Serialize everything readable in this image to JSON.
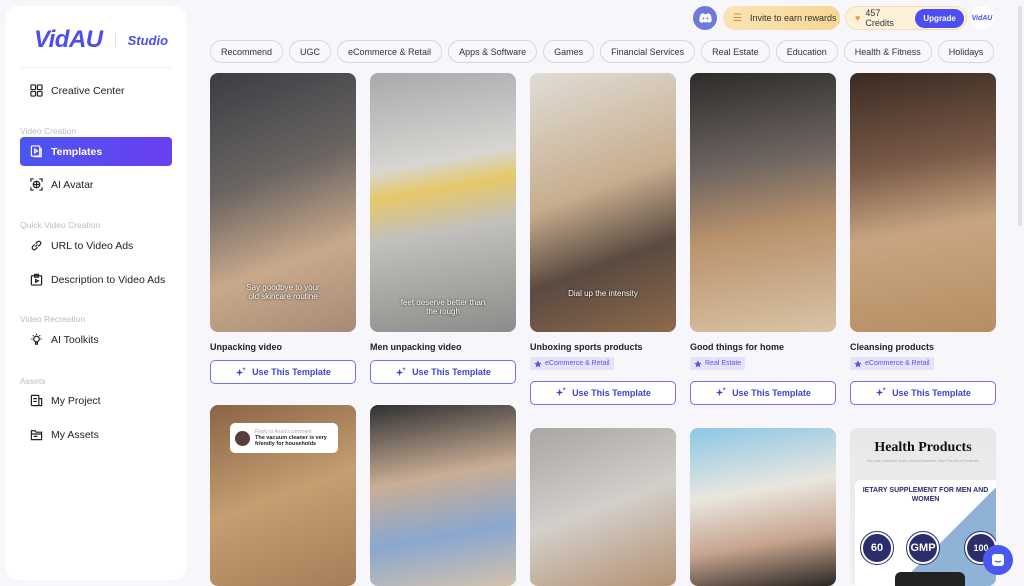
{
  "sidebar": {
    "brand": "VidAU",
    "studio": "Studio",
    "items": [
      {
        "label": "Creative Center",
        "icon": "grid-icon"
      },
      {
        "section": "Video Creation"
      },
      {
        "label": "Templates",
        "icon": "template-icon",
        "active": true
      },
      {
        "label": "AI Avatar",
        "icon": "avatar-scan-icon"
      },
      {
        "section": "Quick Video Creation"
      },
      {
        "label": "URL to Video Ads",
        "icon": "link-icon"
      },
      {
        "label": "Description to Video Ads",
        "icon": "clipboard-video-icon"
      },
      {
        "section": "Video Recreation"
      },
      {
        "label": "AI Toolkits",
        "icon": "bulb-icon"
      },
      {
        "section": "Assets"
      },
      {
        "label": "My Project",
        "icon": "project-icon"
      },
      {
        "label": "My Assets",
        "icon": "folder-icon"
      }
    ]
  },
  "topbar": {
    "invite": "Invite to earn rewards",
    "credits": "457 Credits",
    "upgrade": "Upgrade",
    "avatar": "VidAU"
  },
  "categories": [
    "Recommend",
    "UGC",
    "eCommerce & Retail",
    "Apps & Software",
    "Games",
    "Financial Services",
    "Real Estate",
    "Education",
    "Health & Fitness",
    "Holidays"
  ],
  "use_label": "Use This Template",
  "row1": [
    {
      "title": "Unpacking video",
      "caption": "Say goodbye to your old skincare routine",
      "bg": "linear-gradient(160deg,#3a3d44 0%,#6b6562 40%,#c9a98b 70%,#a68a76 100%)"
    },
    {
      "title": "Men unpacking video",
      "caption": "feet deserve better than the rough",
      "bg": "linear-gradient(170deg,#a8a9ab 0%,#d8d6d2 35%,#e6c86a 45%,#c2c0bc 60%,#8d8c8a 100%)"
    },
    {
      "title": "Unboxing sports products",
      "caption": "Dial up the intensity",
      "tag": "eCommerce & Retail",
      "bg": "linear-gradient(160deg,#e0ddd6 0%,#c7ad8e 45%,#5a4a40 70%,#8d6a4c 100%)"
    },
    {
      "title": "Good things for home",
      "tag": "Real Estate",
      "bg": "linear-gradient(170deg,#2d2b2a 0%,#6d6460 35%,#b9926c 60%,#d9c3a6 100%)"
    },
    {
      "title": "Cleansing products",
      "tag": "eCommerce & Retail",
      "bg": "linear-gradient(170deg,#3a2a22 0%,#7a5a48 35%,#c8a581 60%,#b78e63 100%)"
    }
  ],
  "row2": [
    {
      "bg": "linear-gradient(160deg,#8a6446,#c69e72 50%,#a77d58)",
      "reply": "Reply to Anna's comment",
      "comment": "The vacuum cleaner is very friendly for households"
    },
    {
      "bg": "linear-gradient(170deg,#2f3033,#c9ae94 40%,#8aa7d0 70%,#d3c2ac)"
    },
    {
      "bg": "linear-gradient(160deg,#a9a6a3,#d3cfca 50%,#b49274)"
    },
    {
      "bg": "linear-gradient(170deg,#8cc7e6,#e9e6df 40%,#c7a58f 70%,#2a2522)"
    },
    {
      "bg": "linear-gradient(180deg,#e8e8e8,#f0f0f0)",
      "heading": "Health Products",
      "sub": "You can describe your product features here Function-Features",
      "banner": "IETARY SUPPLEMENT FOR MEN AND WOMEN",
      "badges": [
        "60",
        "GMP",
        "100"
      ]
    }
  ],
  "colors": {
    "accent": "#4b4ef0",
    "background": "#f6f6fb"
  }
}
